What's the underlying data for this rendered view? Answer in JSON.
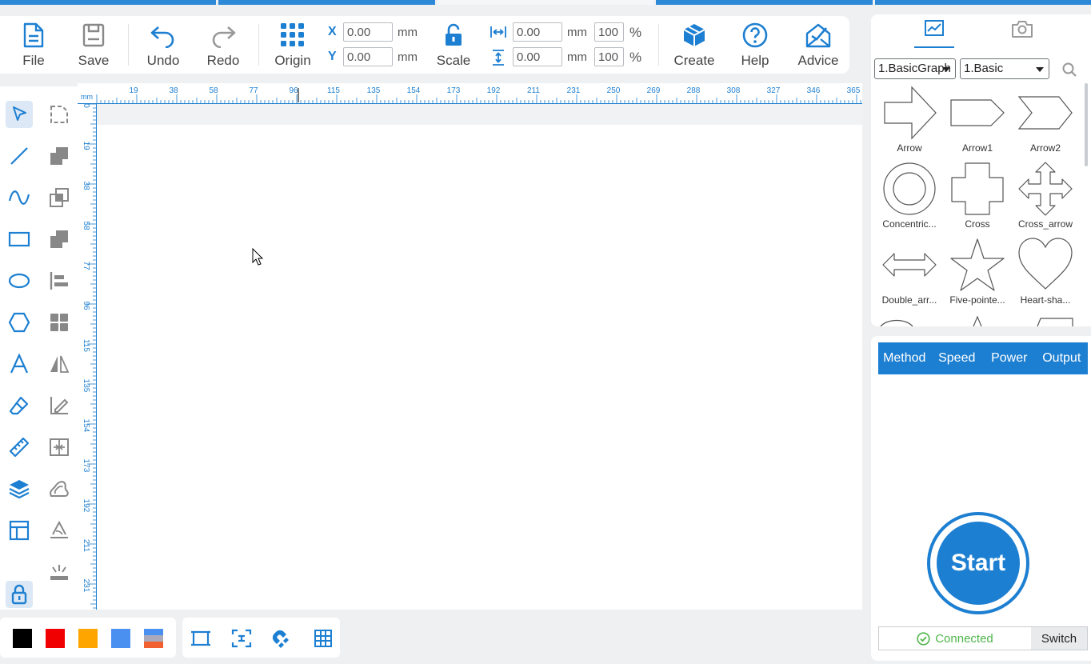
{
  "toolbar": {
    "file": "File",
    "save": "Save",
    "undo": "Undo",
    "redo": "Redo",
    "origin": "Origin",
    "scale": "Scale",
    "create": "Create",
    "help": "Help",
    "advice": "Advice",
    "x_label": "X",
    "y_label": "Y",
    "x_value": "0.00",
    "y_value": "0.00",
    "width_value": "0.00",
    "height_value": "0.00",
    "width_percent": "100",
    "height_percent": "100",
    "unit_mm": "mm",
    "unit_percent": "%"
  },
  "ruler": {
    "unit": "mm",
    "top_ticks": [
      "19",
      "38",
      "58",
      "77",
      "96",
      "115",
      "135",
      "154",
      "173",
      "192",
      "211",
      "231",
      "250",
      "269",
      "288",
      "308",
      "327",
      "346",
      "365"
    ],
    "left_ticks": [
      "0",
      "19",
      "38",
      "58",
      "77",
      "96",
      "115",
      "135",
      "154",
      "173",
      "192",
      "211",
      "231"
    ]
  },
  "left_tools": [
    "select-tool",
    "node-edit-tool",
    "line-tool",
    "union-tool",
    "curve-tool",
    "combine-tool",
    "rectangle-tool",
    "subtract-tool",
    "ellipse-tool",
    "align-tool",
    "polygon-tool",
    "array-tool",
    "text-tool",
    "mirror-tool",
    "eraser-tool",
    "measure-angle-tool",
    "ruler-tool",
    "split-tool",
    "layers-tool",
    "outline-tool",
    "table-tool",
    "path-tool",
    "lock-tool",
    "laser-tool"
  ],
  "palette": {
    "colors": [
      "#000000",
      "#f00000",
      "#ffa500",
      "#4a90f0"
    ]
  },
  "library": {
    "category": "1.BasicGraph",
    "subcategory": "1.Basic",
    "shapes": [
      {
        "name": "Arrow"
      },
      {
        "name": "Arrow1"
      },
      {
        "name": "Arrow2"
      },
      {
        "name": "Concentric..."
      },
      {
        "name": "Cross"
      },
      {
        "name": "Cross_arrow"
      },
      {
        "name": "Double_arr..."
      },
      {
        "name": "Five-pointe..."
      },
      {
        "name": "Heart-sha..."
      }
    ]
  },
  "process": {
    "tabs": [
      "Method",
      "Speed",
      "Power",
      "Output"
    ],
    "start": "Start",
    "status": "Connected",
    "switch": "Switch"
  },
  "colors": {
    "accent": "#1d7fd1",
    "connected": "#4fb64a"
  }
}
